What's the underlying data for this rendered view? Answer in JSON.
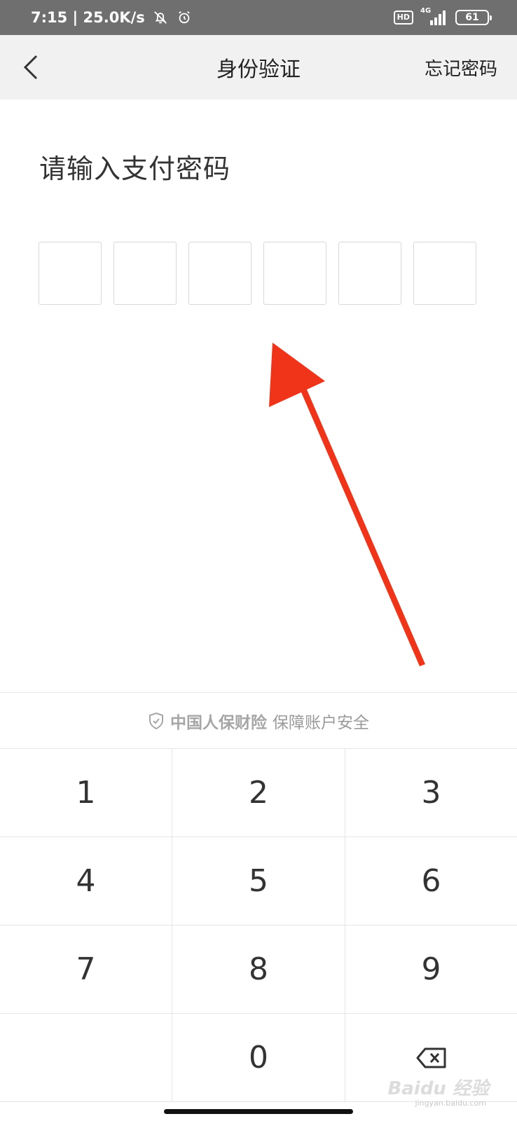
{
  "status_bar": {
    "time_speed": "7:15 | 25.0K/s",
    "hd": "HD",
    "network": "4G",
    "battery": "61"
  },
  "header": {
    "title": "身份验证",
    "forgot_label": "忘记密码"
  },
  "prompt": "请输入支付密码",
  "pin_length": 6,
  "security": {
    "brand": "中国人保财险",
    "text": "保障账户安全"
  },
  "keypad": {
    "keys": [
      "1",
      "2",
      "3",
      "4",
      "5",
      "6",
      "7",
      "8",
      "9",
      "",
      "0",
      "⌫"
    ]
  },
  "watermark": {
    "brand": "Baidu 经验",
    "url": "jingyan.baidu.com"
  },
  "colors": {
    "arrow": "#f0341a",
    "header_bg": "#f1f1f1",
    "status_bg": "#6f6f6f"
  }
}
